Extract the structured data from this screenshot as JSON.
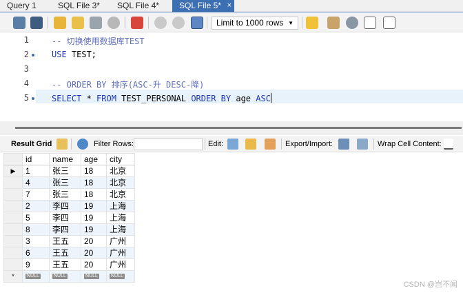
{
  "tabs": [
    {
      "label": "Query 1",
      "active": false
    },
    {
      "label": "SQL File 3*",
      "active": false
    },
    {
      "label": "SQL File 4*",
      "active": false
    },
    {
      "label": "SQL File 5*",
      "active": true
    }
  ],
  "tab_close_glyph": "×",
  "toolbar": {
    "limit_select_value": "Limit to 1000 rows",
    "icons": [
      "open-folder-icon",
      "save-icon",
      "execute-lightning-icon",
      "execute-current-icon",
      "explain-icon",
      "stop-icon",
      "toggle-error-icon",
      "commit-icon",
      "rollback-icon",
      "autocommit-icon",
      "star-icon",
      "brush-icon",
      "search-icon",
      "paragraph-icon",
      "wrap-icon"
    ]
  },
  "editor": {
    "lines": [
      {
        "num": "1",
        "has_dot": false
      },
      {
        "num": "2",
        "has_dot": true
      },
      {
        "num": "3",
        "has_dot": false
      },
      {
        "num": "4",
        "has_dot": false
      },
      {
        "num": "5",
        "has_dot": true
      }
    ],
    "line1_comment": "-- 切换使用数据库TEST",
    "line2_use": "USE",
    "line2_rest": " TEST;",
    "line4_comment": "-- ORDER BY 排序(ASC-升 DESC-降)",
    "line5_select": "SELECT",
    "line5_star": " * ",
    "line5_from": "FROM",
    "line5_table": " TEST_PERSONAL ",
    "line5_order": "ORDER BY",
    "line5_col": " age ",
    "line5_asc": "ASC"
  },
  "result_toolbar": {
    "result_grid_label": "Result Grid",
    "filter_rows_label": "Filter Rows:",
    "edit_label": "Edit:",
    "export_import_label": "Export/Import:",
    "wrap_cell_label": "Wrap Cell Content:"
  },
  "grid": {
    "columns": [
      "id",
      "name",
      "age",
      "city"
    ],
    "rows": [
      [
        "1",
        "张三",
        "18",
        "北京"
      ],
      [
        "4",
        "张三",
        "18",
        "北京"
      ],
      [
        "7",
        "张三",
        "18",
        "北京"
      ],
      [
        "2",
        "李四",
        "19",
        "上海"
      ],
      [
        "5",
        "李四",
        "19",
        "上海"
      ],
      [
        "8",
        "李四",
        "19",
        "上海"
      ],
      [
        "3",
        "王五",
        "20",
        "广州"
      ],
      [
        "6",
        "王五",
        "20",
        "广州"
      ],
      [
        "9",
        "王五",
        "20",
        "广州"
      ]
    ],
    "null_label": "NULL",
    "current_row_marker": "▶",
    "new_row_marker": "*"
  },
  "watermark": "CSDN @岂不闻",
  "colors": {
    "tab_active": "#3d6fb3",
    "keyword": "#1e38b5",
    "comment": "#5f6fb8",
    "row_alt": "#eef4fb"
  }
}
